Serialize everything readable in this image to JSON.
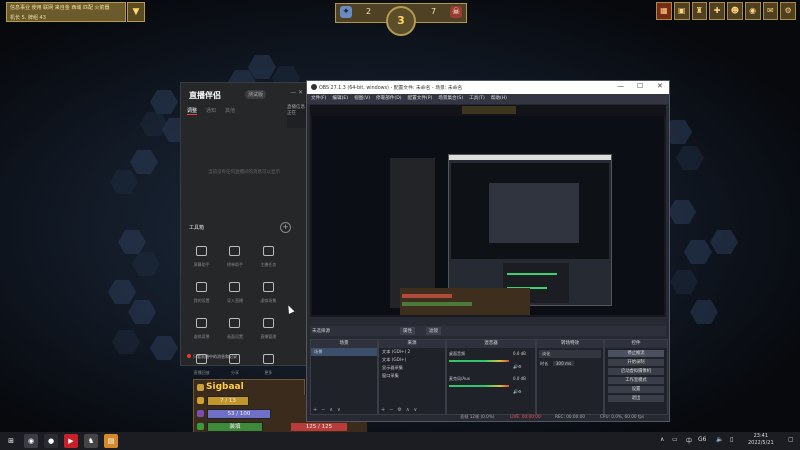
{
  "game": {
    "topleft_line1": "信息事业 使用 联网 来自金 西域 匹配 火箭器",
    "topleft_line2": "机长  5. 牌组  43",
    "score": {
      "left": "2",
      "right": "7",
      "round": "3"
    },
    "player": {
      "name": "Sigbaal",
      "bar1": "7 / 13",
      "bar2": "53 / 100",
      "bar3": "装填",
      "bar4": "125 / 125"
    }
  },
  "live_app": {
    "logo": "直播伴侣",
    "version": "测试版",
    "tabs": [
      "调整",
      "通知",
      "其他"
    ],
    "empty_hint": "当前没有任何直播间的消息可以显示",
    "tools_title": "工具箱",
    "tools": [
      {
        "label": "屏幕助手",
        "icon": "screen-icon"
      },
      {
        "label": "榜单助手",
        "icon": "user-icon"
      },
      {
        "label": "主播任务",
        "icon": "task-icon"
      },
      {
        "label": "我的设置",
        "icon": "settings-icon"
      },
      {
        "label": "导入直播",
        "icon": "import-icon"
      },
      {
        "label": "虚拟场景",
        "icon": "scene-icon"
      },
      {
        "label": "虚拟背景",
        "icon": "background-icon"
      },
      {
        "label": "画面设置",
        "icon": "image-icon"
      },
      {
        "label": "直播管理",
        "icon": "manage-icon"
      },
      {
        "label": "直播回放",
        "icon": "replay-icon"
      },
      {
        "label": "分享",
        "icon": "share-icon"
      },
      {
        "label": "更多",
        "icon": "more-icon"
      }
    ],
    "footer": "只看直播中的消息和记录",
    "side_title": "直播信息",
    "side_badge": "正在"
  },
  "obs": {
    "title": "OBS 27.1.3 (64-bit, windows) - 配置文件: 未命名 - 场景: 未命名",
    "menu": [
      "文件(F)",
      "编辑(E)",
      "视图(V)",
      "停靠部件(D)",
      "配置文件(P)",
      "场景集合(S)",
      "工具(T)",
      "帮助(H)"
    ],
    "no_source_label": "未选择源",
    "filter_buttons": [
      "属性",
      "滤镜"
    ],
    "docks": {
      "scenes": {
        "title": "场景",
        "items": [
          "场景"
        ]
      },
      "sources": {
        "title": "来源",
        "items": [
          "文本 (GDI+) 2",
          "文本 (GDI+)",
          "显示器采集",
          "窗口采集"
        ]
      },
      "mixer": {
        "title": "混音器",
        "channels": [
          {
            "name": "桌面音频",
            "db": "0.0 dB"
          },
          {
            "name": "麦克风/Aux",
            "db": "0.0 dB"
          }
        ]
      },
      "transitions": {
        "title": "转场特效",
        "type": "淡化",
        "duration_label": "时长",
        "duration_value": "300 ms"
      },
      "controls": {
        "title": "控件",
        "buttons": [
          "停止推流",
          "开始录制",
          "启动虚拟摄像机",
          "工作室模式",
          "设置",
          "退出"
        ]
      }
    },
    "status": {
      "dropped": "丢帧 12帧 (0.0%)",
      "live": "LIVE: 00:00:00",
      "rec": "REC: 00:00:00",
      "cpu": "CPU: 0.0%, 60.00 fps"
    }
  },
  "taskbar": {
    "apps": [
      "开始",
      "搜索",
      "OBS",
      "直播伴侣",
      "游戏"
    ],
    "tray_lang": "中",
    "tray_ime": "G6",
    "time": "23:41",
    "date": "2022/5/21"
  }
}
